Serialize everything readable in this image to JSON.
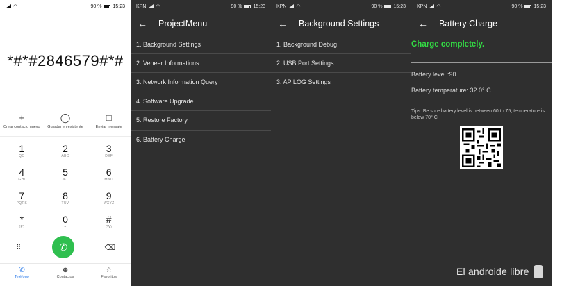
{
  "dialer": {
    "status": {
      "time": "15:23",
      "battery": "90 %"
    },
    "code": "*#*#2846579#*#",
    "actions": [
      {
        "label": "Crear contacto nuevo",
        "icon": "plus-icon"
      },
      {
        "label": "Guardar en existente",
        "icon": "person-icon"
      },
      {
        "label": "Enviar mensaje",
        "icon": "message-icon"
      }
    ],
    "keys": [
      {
        "digit": "1",
        "letters": "QO"
      },
      {
        "digit": "2",
        "letters": "ABC"
      },
      {
        "digit": "3",
        "letters": "DEF"
      },
      {
        "digit": "4",
        "letters": "GHI"
      },
      {
        "digit": "5",
        "letters": "JKL"
      },
      {
        "digit": "6",
        "letters": "MNO"
      },
      {
        "digit": "7",
        "letters": "PQRS"
      },
      {
        "digit": "8",
        "letters": "TUV"
      },
      {
        "digit": "9",
        "letters": "WXYZ"
      },
      {
        "digit": "*",
        "letters": "(P)"
      },
      {
        "digit": "0",
        "letters": "+"
      },
      {
        "digit": "#",
        "letters": "(W)"
      }
    ],
    "tabs": [
      {
        "label": "Teléfono",
        "icon": "phone-icon"
      },
      {
        "label": "Contactos",
        "icon": "contacts-icon"
      },
      {
        "label": "Favoritos",
        "icon": "star-icon"
      }
    ]
  },
  "statusbar": {
    "carrier": "KPN",
    "battery": "90 %",
    "time": "15:23"
  },
  "project_menu": {
    "title": "ProjectMenu",
    "items": [
      "1. Background Settings",
      "2. Veneer Informations",
      "3. Network Information Query",
      "4. Software Upgrade",
      "5. Restore Factory",
      "6. Battery Charge"
    ]
  },
  "background_settings": {
    "title": "Background Settings",
    "items": [
      "1. Background Debug",
      "2. USB Port Settings",
      "3. AP LOG Settings"
    ]
  },
  "battery_charge": {
    "title": "Battery Charge",
    "status": "Charge completely.",
    "level": "Battery level :90",
    "temperature": "Battery temperature: 32.0° C",
    "tips": "Tips: Be sure battery level is between 60 to 75, temperature is below 70° C"
  },
  "watermark": "El androide libre",
  "colors": {
    "charge_green": "#33dd44",
    "call_green": "#2fbf4f",
    "tab_active": "#1d72e8",
    "dark_bg": "#2f2f2f"
  }
}
